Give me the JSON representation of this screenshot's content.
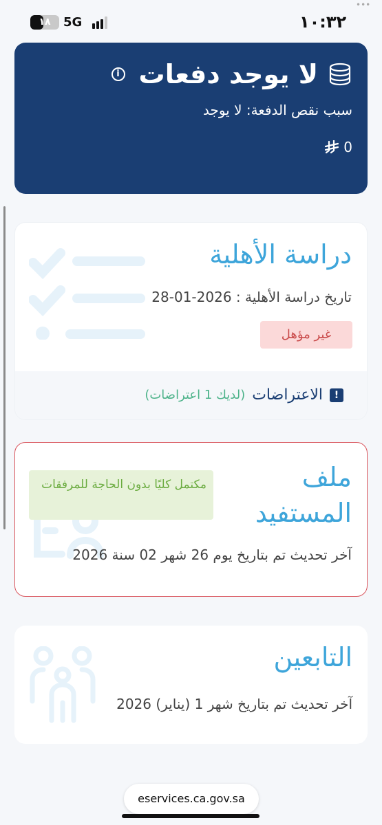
{
  "status_bar": {
    "time": "١٠:٣٢",
    "battery_label": "١٨",
    "battery_level": 0.18,
    "network": "5G"
  },
  "payments": {
    "title": "لا يوجد دفعات",
    "reason": "سبب نقص الدفعة: لا يوجد",
    "amount": "0"
  },
  "eligibility": {
    "title": "دراسة الأهلية",
    "date": "تاريخ دراسة الأهلية : 2026-01-28",
    "status": "غير مؤهل",
    "objections_label": "الاعتراضات",
    "objections_count": "(لديك 1 اعتراضات)"
  },
  "profile": {
    "title": "ملف المستفيد",
    "status": "مكتمل كليًا بدون الحاجة للمرفقات",
    "updated": "آخر تحديث تم بتاريخ يوم 26 شهر 02 سنة 2026"
  },
  "dependents": {
    "title": "التابعين",
    "updated": "آخر تحديث تم بتاريخ شهر 1 (يناير) 2026"
  },
  "browser": {
    "url": "eservices.ca.gov.sa"
  },
  "colors": {
    "navy": "#1a3e73",
    "accent_blue": "#3ea5da",
    "error_red": "#d9545c",
    "success_green": "#6aab3f"
  }
}
